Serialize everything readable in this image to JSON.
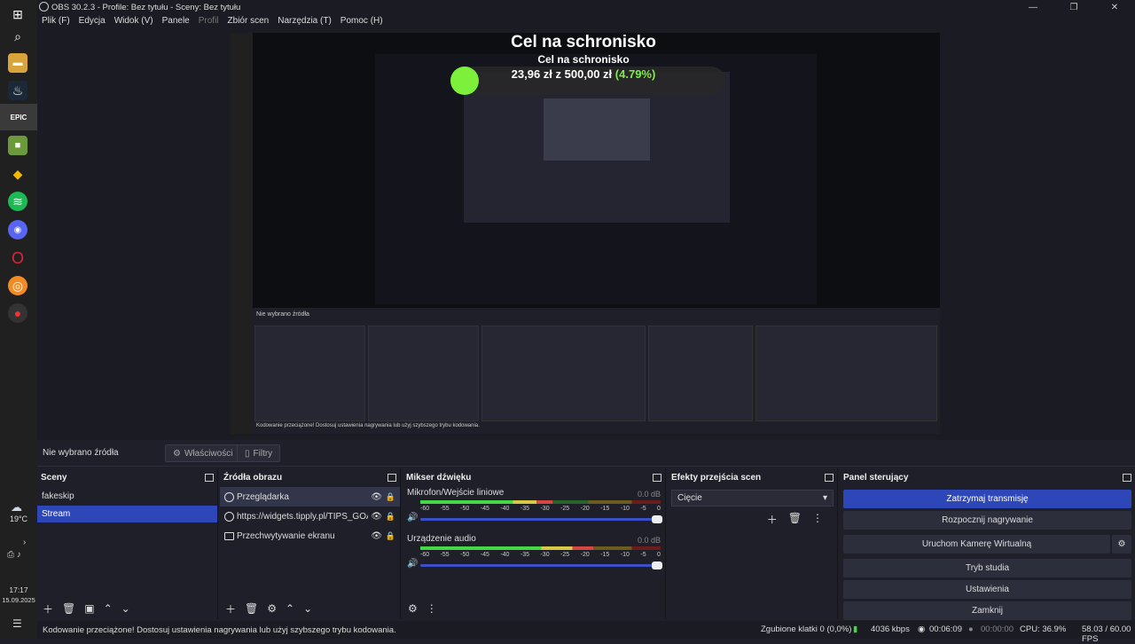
{
  "window": {
    "title": "OBS 30.2.3 - Profile: Bez tytułu - Sceny: Bez tytułu"
  },
  "menu": [
    "Plik (F)",
    "Edycja",
    "Widok (V)",
    "Panele",
    "Profil",
    "Zbiór scen",
    "Narzędzia (T)",
    "Pomoc (H)"
  ],
  "taskbar": {
    "weather": "19°C",
    "time": "17:17",
    "date": "15.09.2025"
  },
  "preview": {
    "goal_title": "Cel na schronisko",
    "goal_title_small": "Cel na schronisko",
    "goal_amount_prefix": "23,96 zł",
    "goal_amount_mid": "z",
    "goal_amount_total": "500,00 zł",
    "goal_percent": "(4.79%)",
    "goal_progress": 0.0479,
    "nested_status": "Kodowanie przeciążone! Dostosuj ustawienia nagrywania lub użyj szybszego trybu kodowania."
  },
  "source_bar": {
    "label": "Nie wybrano źródła",
    "properties": "Właściwości",
    "filters": "Filtry"
  },
  "scenes": {
    "title": "Sceny",
    "items": [
      "fakeskip",
      "Stream"
    ],
    "selected": 1
  },
  "sources": {
    "title": "Źródła obrazu",
    "items": [
      {
        "label": "Przeglądarka",
        "icon": "globe-icon"
      },
      {
        "label": "https://widgets.tipply.pl/TIPS_GOAL",
        "icon": "globe-icon"
      },
      {
        "label": "Przechwytywanie ekranu",
        "icon": "monitor-icon"
      }
    ]
  },
  "mixer": {
    "title": "Mikser dźwięku",
    "channels": [
      {
        "name": "Mikrofon/Wejście liniowe",
        "db": "0.0 dB",
        "level": 0.55
      },
      {
        "name": "Urządzenie audio",
        "db": "0.0 dB",
        "level": 0.72
      }
    ],
    "ticks": [
      "-60",
      "-55",
      "-50",
      "-45",
      "-40",
      "-35",
      "-30",
      "-25",
      "-20",
      "-15",
      "-10",
      "-5",
      "0"
    ]
  },
  "transitions": {
    "title": "Efekty przejścia scen",
    "selected": "Cięcie"
  },
  "controls": {
    "title": "Panel sterujący",
    "buttons": [
      "Zatrzymaj transmisję",
      "Rozpocznij nagrywanie",
      "Uruchom Kamerę Wirtualną",
      "Tryb studia",
      "Ustawienia",
      "Zamknij"
    ]
  },
  "status": {
    "message": "Kodowanie przeciążone! Dostosuj ustawienia nagrywania lub użyj szybszego trybu kodowania.",
    "dropped": "Zgubione klatki 0 (0,0%)",
    "bitrate": "4036 kbps",
    "stream_time": "00:06:09",
    "rec_time": "00:00:00",
    "cpu": "CPU: 36.9%",
    "fps": "58.03 / 60.00 FPS"
  },
  "colors": {
    "accent": "#2d47b8",
    "goal_green": "#7cf03a",
    "bg": "#1e1f29"
  }
}
